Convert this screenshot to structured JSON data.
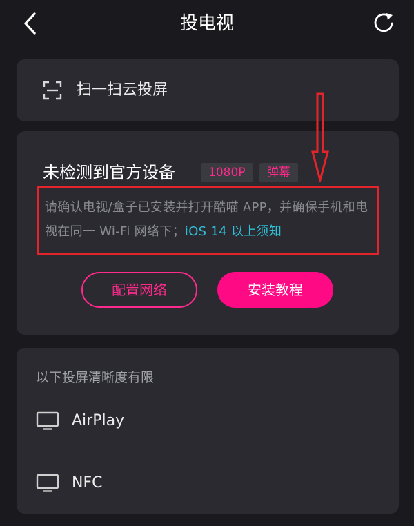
{
  "header": {
    "title": "投电视"
  },
  "scan": {
    "label": "扫一扫云投屏"
  },
  "device": {
    "title": "未检测到官方设备",
    "badges": [
      "1080P",
      "弹幕"
    ],
    "notice_text": "请确认电视/盒子已安装并打开酷喵 APP，并确保手机和电视在同一 Wi-Fi 网络下；",
    "notice_link": "iOS 14 以上须知",
    "config_button": "配置网络",
    "install_button": "安装教程"
  },
  "limited": {
    "header": "以下投屏清晰度有限",
    "options": [
      {
        "label": "AirPlay",
        "icon": "tv-icon"
      },
      {
        "label": "NFC",
        "icon": "tv-icon"
      }
    ]
  },
  "colors": {
    "background": "#1a1a1e",
    "card": "#2a2a30",
    "accent_pink": "#ff0a85",
    "link_cyan": "#2fc0d8",
    "annotation_red": "#e3252b"
  }
}
